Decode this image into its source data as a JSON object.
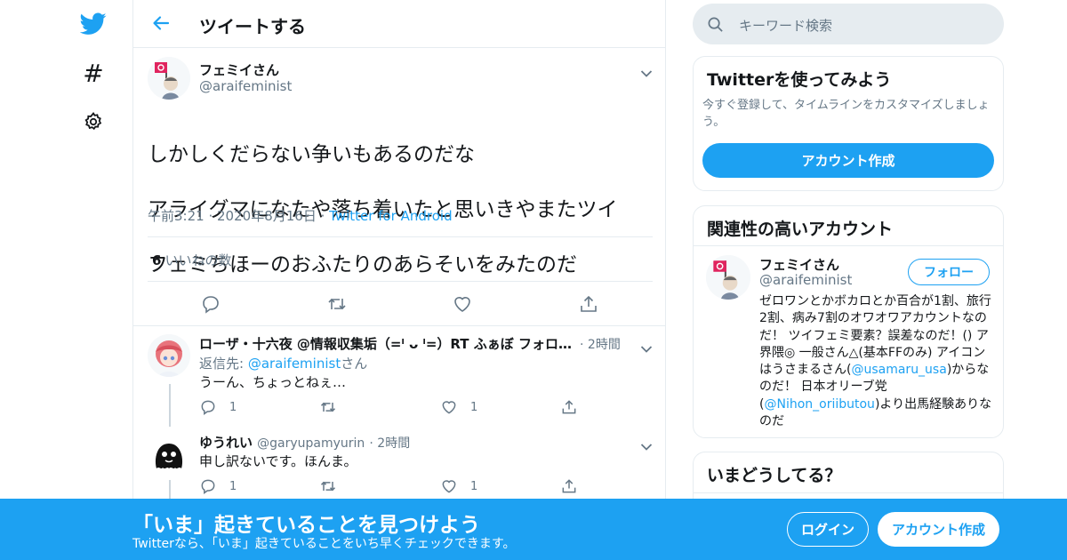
{
  "header": {
    "title": "ツイートする"
  },
  "tweet": {
    "name": "フェミイさん",
    "handle": "@araifeminist",
    "lines": [
      "しかしくだらない争いもあるのだな",
      "アライグマになたや落ち着いたと思いきやまたツイ",
      "フェミちほーのおふたりのあらそいをみたのだ"
    ],
    "time": "午前3:21",
    "date": "2020年8月16日",
    "source": "Twitter for Android",
    "likes_count": "6",
    "likes_label": "いいねの数"
  },
  "replies": [
    {
      "name": "ローザ・十六夜 @情報収集垢（=ˡ ᴗ ˡ=）RT ふぁぼ フォロ…",
      "time": "2時間",
      "reply_to_prefix": "返信先: ",
      "reply_to_handle": "@araifeminist",
      "reply_to_suffix": "さん",
      "text": "うーん、ちょっとねぇ…",
      "reply_count": "1",
      "like_count": "1"
    },
    {
      "name": "ゆうれい",
      "handle": "@garyupamyurin",
      "time": "2時間",
      "text": "申し訳ないです。ほんま。",
      "reply_count": "1",
      "like_count": "1"
    }
  ],
  "search": {
    "placeholder": "キーワード検索"
  },
  "signup_card": {
    "title": "Twitterを使ってみよう",
    "desc": "今すぐ登録して、タイムラインをカスタマイズしましょう。",
    "button": "アカウント作成"
  },
  "related_card": {
    "title": "関連性の高いアカウント",
    "name": "フェミイさん",
    "handle": "@araifeminist",
    "follow": "フォロー",
    "bio_1": "ゼロワンとかボカロとか百合が1割、旅行2割、病み7割のオワオワアカウントなのだ！ ツイフェミ要素？誤差なのだ！() ア界隈◎ 一般さん△(基本FFのみ) アイコンはうさまるさん(",
    "bio_link_1": "@usamaru_usa",
    "bio_2": ")からなのだ！ 日本オリーブ党(",
    "bio_link_2": "@Nihon_oriibutou",
    "bio_3": ")より出馬経験ありなのだ"
  },
  "trends_card": {
    "title": "いまどうしてる？"
  },
  "banner": {
    "title": "「いま」起きていることを見つけよう",
    "subtitle": "Twitterなら、「いま」起きていることをいち早くチェックできます。",
    "login": "ログイン",
    "signup": "アカウント作成"
  },
  "colors": {
    "accent": "#1da1f2",
    "muted": "#657786",
    "border": "#e6ecf0"
  }
}
